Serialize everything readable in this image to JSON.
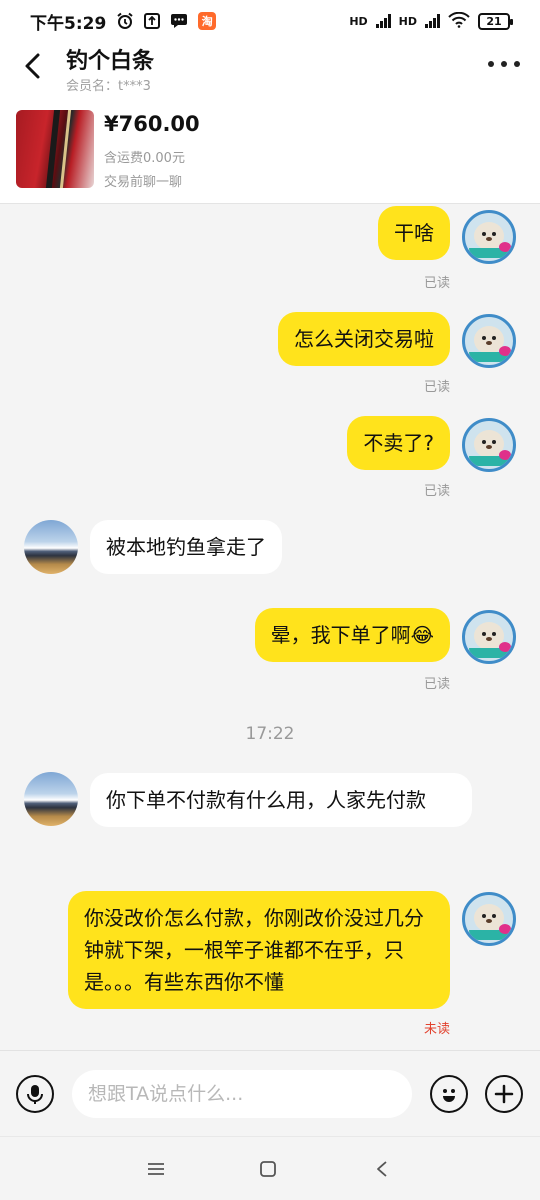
{
  "status_bar": {
    "time": "下午5:29",
    "alarm_icon": "alarm-clock-icon",
    "upload_icon": "upload-icon",
    "message_icon": "message-icon",
    "app_icon_text": "淘",
    "network_1": "HD",
    "network_2": "HD",
    "battery": "21"
  },
  "header": {
    "title": "钓个白条",
    "member_label": "会员名：t***3",
    "back_icon": "chevron-left-icon",
    "more_icon": "more-horizontal-icon"
  },
  "product": {
    "price": "¥760.00",
    "shipping": "含运费0.00元",
    "chat_hint": "交易前聊一聊"
  },
  "messages": [
    {
      "side": "me",
      "text": "干啥",
      "status": "已读"
    },
    {
      "side": "me",
      "text": "怎么关闭交易啦",
      "status": "已读"
    },
    {
      "side": "me",
      "text": "不卖了?",
      "status": "已读"
    },
    {
      "side": "other",
      "text": "被本地钓鱼拿走了"
    },
    {
      "side": "me",
      "text": "晕，我下单了啊😂",
      "status": "已读"
    },
    {
      "side": "other",
      "text": "你下单不付款有什么用，人家先付款"
    },
    {
      "side": "me",
      "text": "你没改价怎么付款，你刚改价没过几分钟就下架，一根竿子谁都不在乎，只是。。。有些东西你不懂",
      "status": "未读"
    }
  ],
  "timestamp": "17:22",
  "input_bar": {
    "placeholder": "想跟TA说点什么...",
    "voice_icon": "microphone-icon",
    "emoji_icon": "emoji-icon",
    "plus_icon": "plus-icon"
  },
  "colors": {
    "my_bubble": "#ffe31c",
    "other_bubble": "#ffffff",
    "unread": "#e2422e",
    "background": "#f4f4f4"
  }
}
